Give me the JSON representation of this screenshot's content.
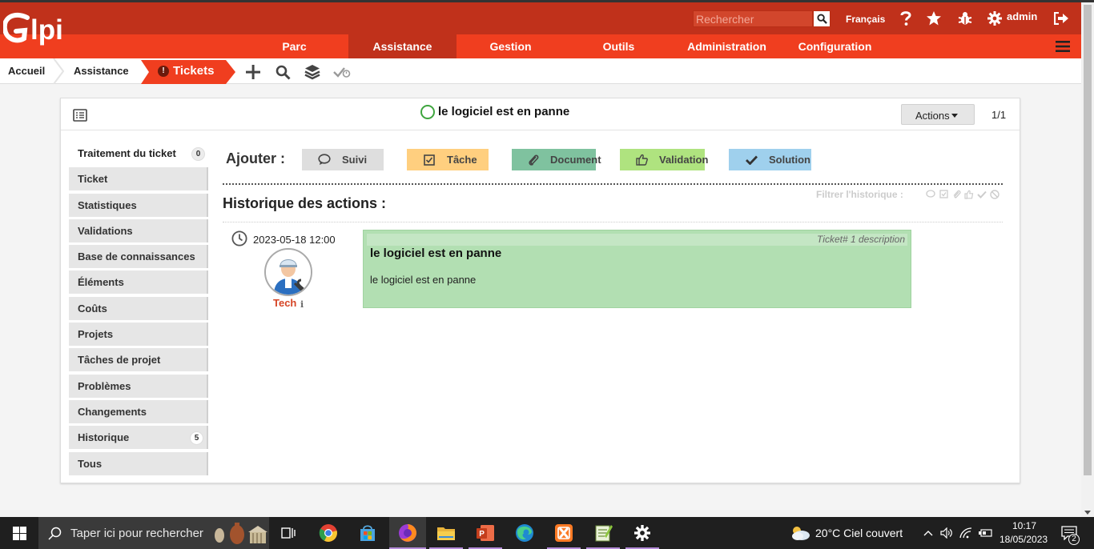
{
  "header": {
    "search_placeholder": "Rechercher",
    "language": "Français",
    "user": "admin"
  },
  "nav": {
    "items": [
      "Parc",
      "Assistance",
      "Gestion",
      "Outils",
      "Administration",
      "Configuration"
    ],
    "active": "Assistance"
  },
  "breadcrumb": {
    "home": "Accueil",
    "section": "Assistance",
    "current": "Tickets"
  },
  "ticket": {
    "title": "le logiciel est en panne",
    "actions_label": "Actions",
    "pager": "1/1",
    "status_color": "#3fa53f"
  },
  "tabs": [
    {
      "label": "Traitement du ticket",
      "badge": "0"
    },
    {
      "label": "Ticket"
    },
    {
      "label": "Statistiques"
    },
    {
      "label": "Validations"
    },
    {
      "label": "Base de connaissances"
    },
    {
      "label": "Éléments"
    },
    {
      "label": "Coûts"
    },
    {
      "label": "Projets"
    },
    {
      "label": "Tâches de projet"
    },
    {
      "label": "Problèmes"
    },
    {
      "label": "Changements"
    },
    {
      "label": "Historique",
      "badge": "5"
    },
    {
      "label": "Tous"
    }
  ],
  "add": {
    "label": "Ajouter :",
    "buttons": [
      {
        "label": "Suivi",
        "color": "#dedede",
        "icon": "comment-icon"
      },
      {
        "label": "Tâche",
        "color": "#ffcf7f",
        "icon": "checkbox-icon"
      },
      {
        "label": "Document",
        "color": "#7fc29f",
        "icon": "paperclip-icon"
      },
      {
        "label": "Validation",
        "color": "#afe37f",
        "icon": "thumbs-up-icon"
      },
      {
        "label": "Solution",
        "color": "#9fd0ed",
        "icon": "check-icon"
      }
    ]
  },
  "history": {
    "title": "Historique des actions :",
    "filter_label": "Filtrer l'historique :",
    "entry": {
      "date": "2023-05-18 12:00",
      "author": "Tech",
      "meta": "Ticket# 1 description",
      "title": "le logiciel est en panne",
      "body": "le logiciel est en panne"
    }
  },
  "taskbar": {
    "search_text": "Taper ici pour rechercher",
    "weather": "20°C  Ciel couvert",
    "time": "10:17",
    "date": "18/05/2023",
    "notifications": "2"
  }
}
